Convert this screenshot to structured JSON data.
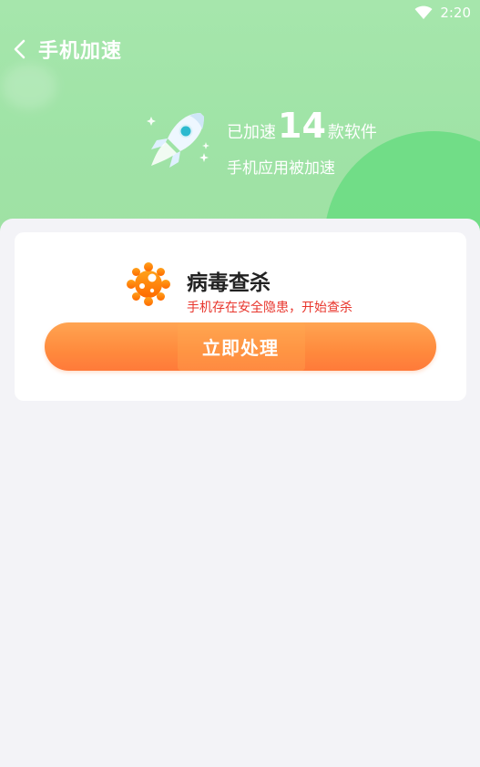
{
  "status_bar": {
    "time": "2:20",
    "icons": [
      "wifi-icon"
    ]
  },
  "title_bar": {
    "back_icon": "chevron-left-icon",
    "title": "手机加速"
  },
  "boost": {
    "prefix": "已加速",
    "count": "14",
    "suffix": "款软件",
    "subtitle": "手机应用被加速",
    "icon": "rocket-icon"
  },
  "card": {
    "icon": "virus-icon",
    "title": "病毒查杀",
    "subtitle": "手机存在安全隐患，开始查杀",
    "button_label": "立即处理"
  },
  "colors": {
    "header_green": "#a6e6ac",
    "accent_orange": "#ff8a3d",
    "warning_red": "#e8352c",
    "page_bg": "#f3f3f7"
  }
}
